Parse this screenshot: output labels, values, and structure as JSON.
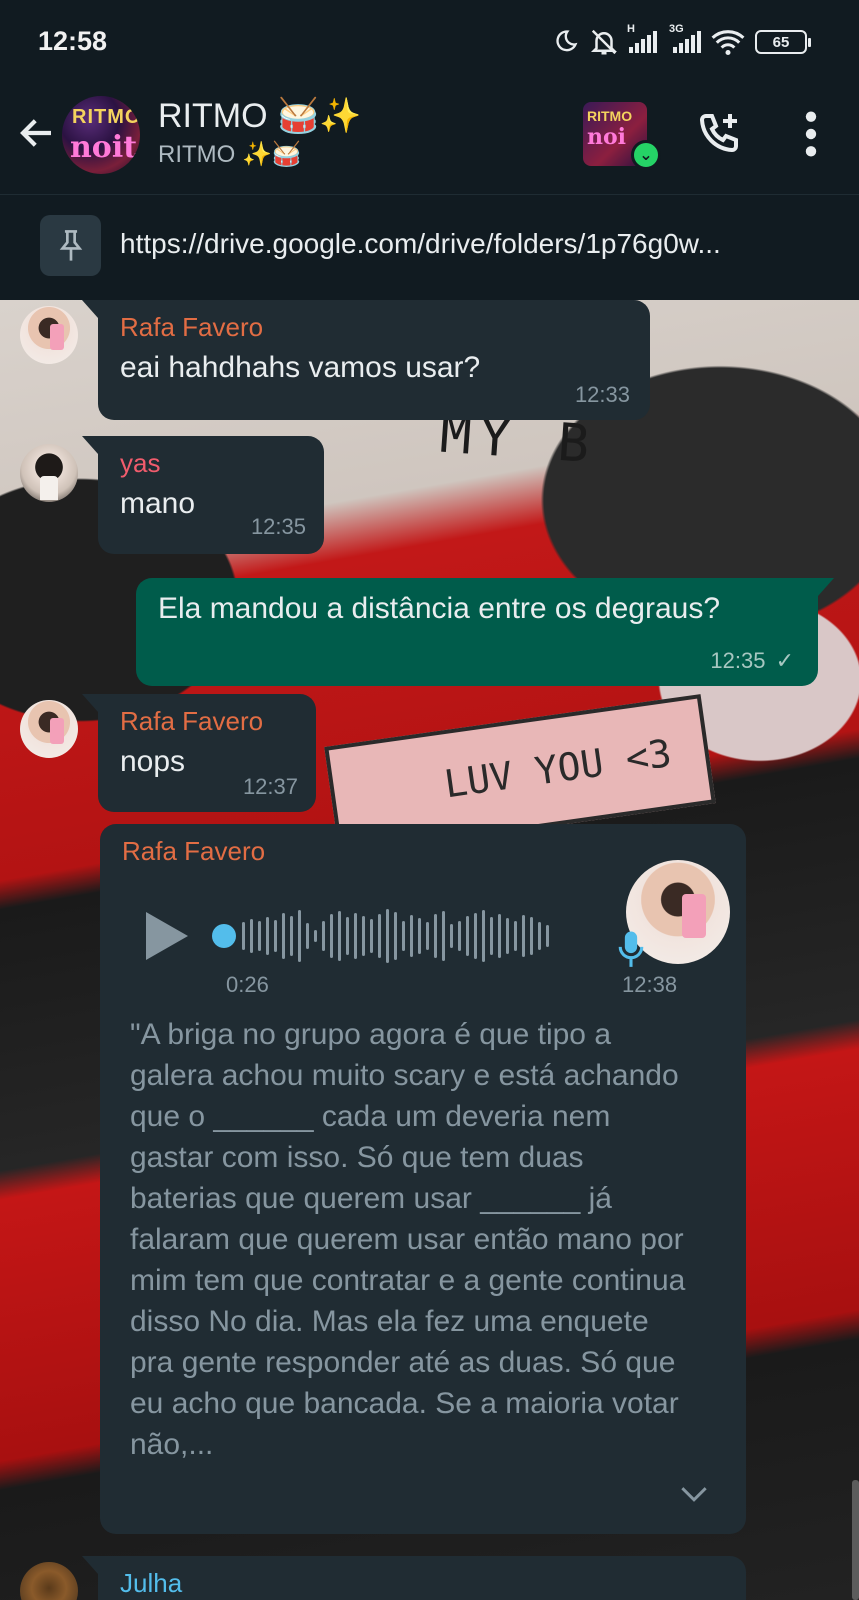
{
  "status_bar": {
    "time": "12:58",
    "network_label_1": "H",
    "network_label_2": "3G",
    "battery": "65"
  },
  "header": {
    "group_name": "RITMO 🥁✨",
    "subtitle": "RITMO ✨🥁",
    "avatar_text_1": "RITMO",
    "avatar_text_2": "noite",
    "call_avatar_text_1": "RITMO",
    "call_avatar_text_2": "noi"
  },
  "pinned": {
    "link": "https://drive.google.com/drive/folders/1p76g0w..."
  },
  "wallpaper": {
    "text_1": "MY B",
    "text_2": "LUV YOU <3"
  },
  "messages": [
    {
      "sender": "Rafa Favero",
      "text": "eai hahdhahs vamos usar?",
      "time": "12:33"
    },
    {
      "sender": "yas",
      "text": "mano",
      "time": "12:35"
    },
    {
      "sender": "me",
      "text": "Ela mandou a distância entre os degraus?",
      "time": "12:35",
      "status": "✓"
    },
    {
      "sender": "Rafa Favero",
      "text": "nops",
      "time": "12:37"
    },
    {
      "sender": "Rafa Favero",
      "type": "voice",
      "duration": "0:26",
      "time": "12:38",
      "transcript": "\"A briga no grupo agora é que tipo a galera achou muito scary e está achando que o ______ cada um deveria nem gastar com isso. Só que tem duas baterias que querem usar ______ já falaram que querem usar então mano por mim tem que contratar e a gente continua disso No dia. Mas ela fez uma enquete pra gente responder até as duas. Só que eu acho que bancada. Se a maioria votar não,..."
    },
    {
      "sender": "Julha"
    }
  ],
  "colors": {
    "incoming_bubble": "#202c33",
    "outgoing_bubble": "#005c4b",
    "rafa_name": "#e26d44",
    "yas_name": "#f15c6d",
    "julha_name": "#53bdeb",
    "voice_dot": "#53bdeb"
  }
}
